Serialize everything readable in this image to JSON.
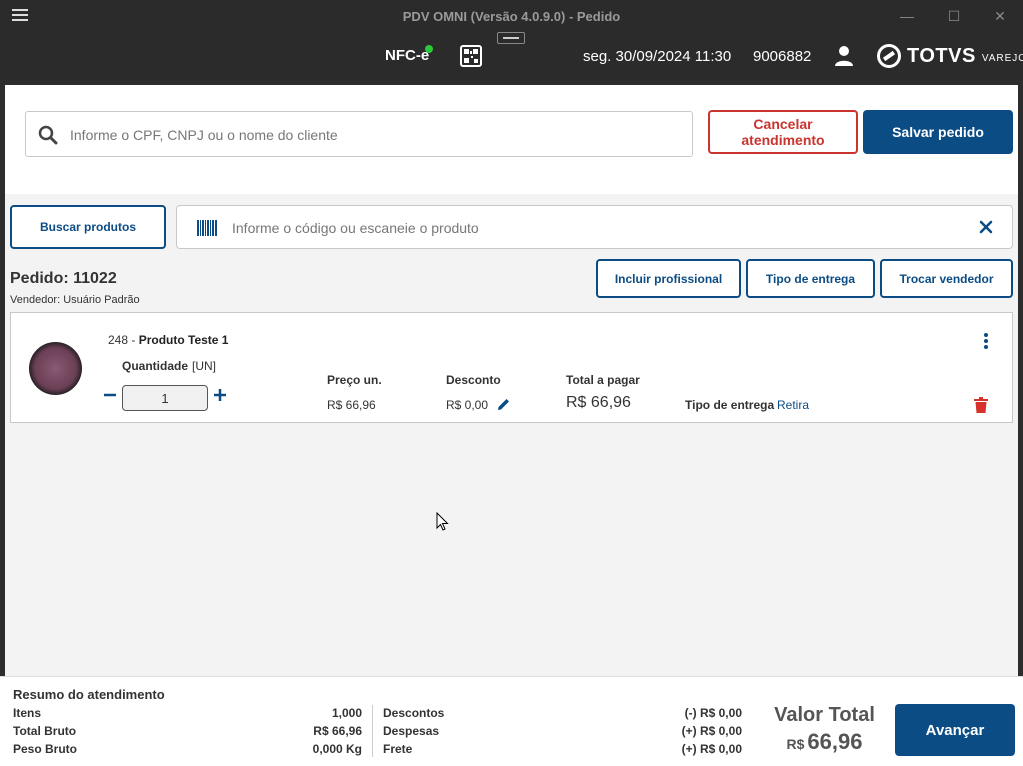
{
  "window": {
    "title": "PDV OMNI (Versão 4.0.9.0) - Pedido",
    "minimize": "—",
    "maximize": "☐",
    "close": "✕"
  },
  "header": {
    "fiscal_mode": "NFC-e",
    "datetime": "seg. 30/09/2024 11:30",
    "operator_id": "9006882",
    "brand": "TOTVS",
    "brand_sub": "VAREJO"
  },
  "client_search": {
    "placeholder": "Informe o CPF, CNPJ ou o nome do cliente",
    "value": ""
  },
  "actions": {
    "cancel_label": "Cancelar atendimento",
    "save_label": "Salvar pedido"
  },
  "product_bar": {
    "search_button": "Buscar produtos",
    "placeholder": "Informe o código ou escaneie o produto",
    "value": ""
  },
  "order": {
    "title": "Pedido: 11022",
    "seller": "Vendedor: Usuário Padrão",
    "buttons": {
      "professional": "Incluir profissional",
      "delivery_type": "Tipo de entrega",
      "change_seller": "Trocar vendedor"
    }
  },
  "item": {
    "code": "248 - ",
    "name": "Produto Teste 1",
    "qty_label": "Quantidade",
    "qty_unit": "[UN]",
    "qty_value": "1",
    "unit_price_label": "Preço un.",
    "unit_price": "R$ 66,96",
    "discount_label": "Desconto",
    "discount": "R$ 0,00",
    "total_label": "Total a pagar",
    "total": "R$ 66,96",
    "delivery_label": "Tipo de entrega",
    "delivery_value": "Retira"
  },
  "summary": {
    "title": "Resumo do atendimento",
    "left": [
      {
        "label": "Itens",
        "value": "1,000"
      },
      {
        "label": "Total Bruto",
        "value": "R$ 66,96"
      },
      {
        "label": "Peso Bruto",
        "value": "0,000 Kg"
      }
    ],
    "right": [
      {
        "label": "Descontos",
        "value": "(-) R$ 0,00"
      },
      {
        "label": "Despesas",
        "value": "(+) R$ 0,00"
      },
      {
        "label": "Frete",
        "value": "(+) R$ 0,00"
      }
    ],
    "total_label": "Valor Total",
    "total_currency": "R$",
    "total_value": "66,96",
    "next_label": "Avançar"
  },
  "colors": {
    "primary": "#0c4c85",
    "danger": "#c9342f",
    "titlebar": "#2b2b2b",
    "status_online": "#2bc93b"
  }
}
